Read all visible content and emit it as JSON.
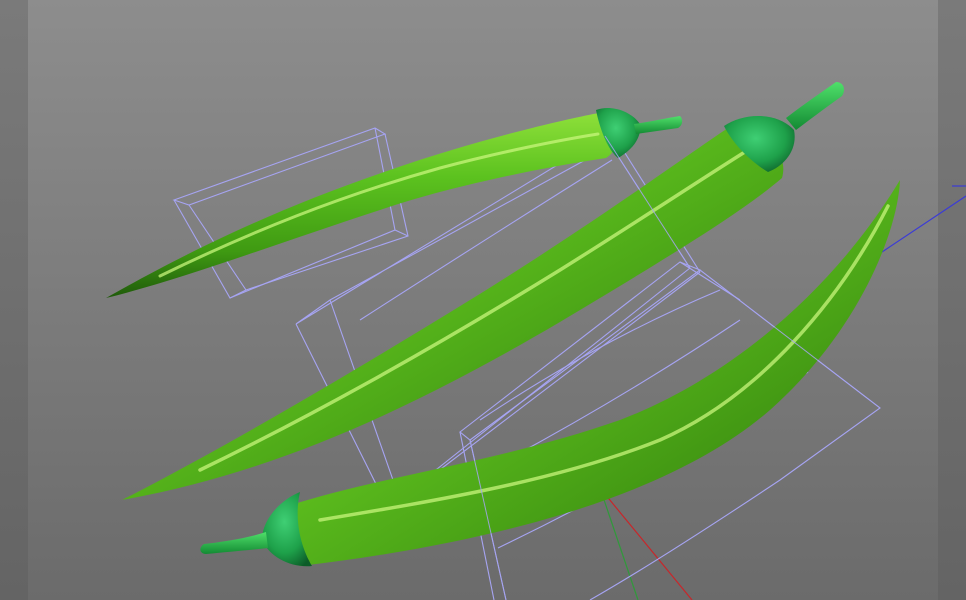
{
  "viewport": {
    "background_gradient": [
      "#8c8c8c",
      "#6a6a6a"
    ],
    "side_band_color": "#727272"
  },
  "scene": {
    "objects": [
      {
        "name": "pepper-top",
        "type": "green-chili-pepper"
      },
      {
        "name": "pepper-middle",
        "type": "green-chili-pepper"
      },
      {
        "name": "pepper-bottom",
        "type": "green-chili-pepper"
      }
    ],
    "colors": {
      "pepper_body": "#4fb81d",
      "pepper_highlight": "#b6ef6a",
      "pepper_shadow": "#1f5a0a",
      "calyx": "#1fa24a",
      "calyx_dark": "#0f6a2c",
      "wireframe": "#a6a4f2",
      "axis_x": "#c8262a",
      "axis_y": "#2f9a3a",
      "axis_z": "#3b3bd6"
    }
  }
}
